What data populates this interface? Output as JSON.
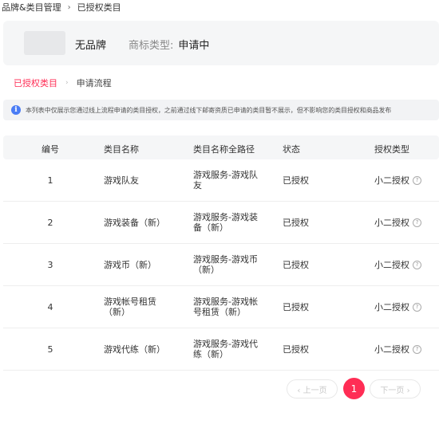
{
  "breadcrumb": {
    "parent": "品牌&类目管理",
    "separator": "›",
    "current": "已授权类目"
  },
  "brand": {
    "name": "无品牌",
    "trademark_label": "商标类型:",
    "trademark_value": "申请中"
  },
  "tabs": {
    "active": "已授权类目",
    "separator": "›",
    "other": "申请流程"
  },
  "notice": {
    "icon": "info-icon",
    "text": "本列表中仅展示您通过线上流程申请的类目授权，之前通过线下邮寄资质已申请的类目暂不展示，但不影响您的类目授权和商品发布"
  },
  "table": {
    "headers": {
      "num": "编号",
      "name": "类目名称",
      "path": "类目名称全路径",
      "status": "状态",
      "type": "授权类型"
    },
    "rows": [
      {
        "num": "1",
        "name": "游戏队友",
        "path": "游戏服务-游戏队友",
        "status": "已授权",
        "type": "小二授权"
      },
      {
        "num": "2",
        "name": "游戏装备（新）",
        "path": "游戏服务-游戏装备（新）",
        "status": "已授权",
        "type": "小二授权"
      },
      {
        "num": "3",
        "name": "游戏币（新）",
        "path": "游戏服务-游戏币（新）",
        "status": "已授权",
        "type": "小二授权"
      },
      {
        "num": "4",
        "name": "游戏帐号租赁（新）",
        "path": "游戏服务-游戏帐号租赁（新）",
        "status": "已授权",
        "type": "小二授权"
      },
      {
        "num": "5",
        "name": "游戏代练（新）",
        "path": "游戏服务-游戏代练（新）",
        "status": "已授权",
        "type": "小二授权"
      }
    ]
  },
  "pagination": {
    "prev": "‹ 上一页",
    "current_page": "1",
    "next": "下一页 ›"
  },
  "colors": {
    "accent": "#ff2d55",
    "info": "#4a7cf5",
    "panel_bg": "#f5f6f7"
  }
}
